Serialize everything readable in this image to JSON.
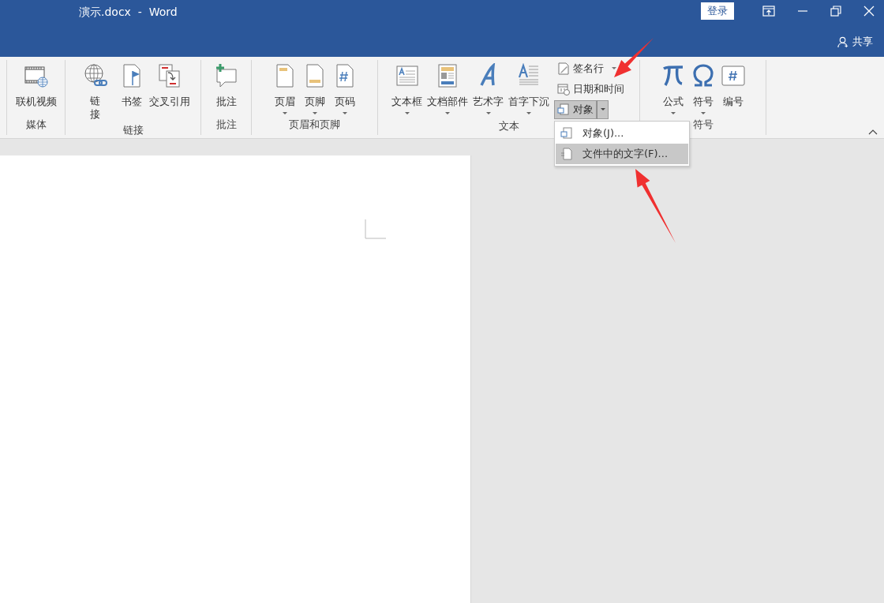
{
  "window": {
    "title": "演示.docx  -  Word"
  },
  "title_bar": {
    "sign_in": "登录",
    "share": "共享"
  },
  "ribbon": {
    "groups": [
      {
        "label": "媒体",
        "items": [
          {
            "kind": "large",
            "label": "联机视频",
            "dropdown": false
          }
        ]
      },
      {
        "label": "链接",
        "items": [
          {
            "kind": "large",
            "label": "链接",
            "dropdown": false
          },
          {
            "kind": "large",
            "label": "书签",
            "dropdown": false
          },
          {
            "kind": "large",
            "label": "交叉引用",
            "dropdown": false
          }
        ]
      },
      {
        "label": "批注",
        "items": [
          {
            "kind": "large",
            "label": "批注",
            "dropdown": false
          }
        ]
      },
      {
        "label": "页眉和页脚",
        "items": [
          {
            "kind": "large",
            "label": "页眉",
            "dropdown": true
          },
          {
            "kind": "large",
            "label": "页脚",
            "dropdown": true
          },
          {
            "kind": "large",
            "label": "页码",
            "dropdown": true
          }
        ]
      },
      {
        "label": "文本",
        "items": [
          {
            "kind": "large",
            "label": "文本框",
            "dropdown": true
          },
          {
            "kind": "large",
            "label": "文档部件",
            "dropdown": true
          },
          {
            "kind": "large",
            "label": "艺术字",
            "dropdown": true
          },
          {
            "kind": "large",
            "label": "首字下沉",
            "dropdown": true
          },
          {
            "kind": "stack",
            "items": [
              {
                "label": "签名行",
                "dropdown": true,
                "pressed": false
              },
              {
                "label": "日期和时间",
                "dropdown": false,
                "pressed": false
              },
              {
                "label": "对象",
                "dropdown": true,
                "pressed": true
              }
            ]
          }
        ]
      },
      {
        "label": "符号",
        "items": [
          {
            "kind": "large",
            "label": "公式",
            "dropdown": true
          },
          {
            "kind": "large",
            "label": "符号",
            "dropdown": true
          },
          {
            "kind": "large",
            "label": "编号",
            "dropdown": false
          }
        ]
      }
    ]
  },
  "menu": {
    "items": [
      {
        "label": "对象(J)...",
        "selected": false
      },
      {
        "label": "文件中的文字(F)...",
        "selected": true
      }
    ]
  }
}
